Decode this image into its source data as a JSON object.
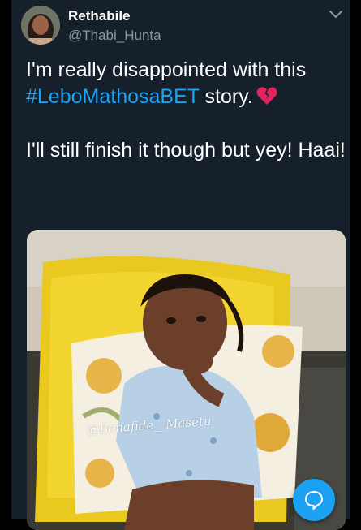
{
  "tweet": {
    "display_name": "Rethabile",
    "handle": "@Thabi_Hunta",
    "text_line1_prefix": "I'm really disappointed with this",
    "hashtag": "#LeboMathosaBET",
    "text_line2_suffix": " story.",
    "text_paragraph2": "I'll still finish it though but yey! Haai!",
    "emoji": "broken-heart-icon",
    "media_watermark": "@Bonafide__Masetu"
  },
  "icons": {
    "menu": "chevron-down-icon",
    "fab": "reply-bubble-icon"
  },
  "colors": {
    "background": "#15202b",
    "text": "#ffffff",
    "secondary_text": "#8899a6",
    "accent": "#1da1f2",
    "emoji": "#e0245e"
  }
}
